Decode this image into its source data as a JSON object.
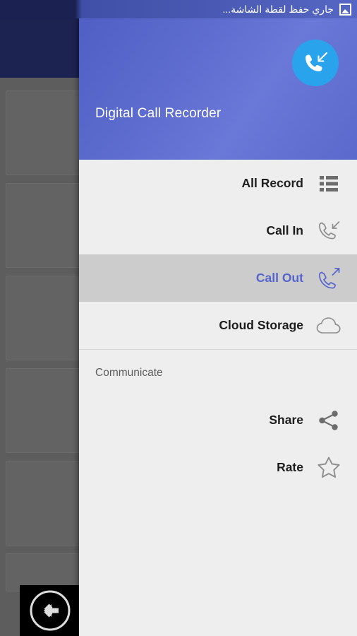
{
  "status_bar": {
    "text": "جاري حفظ لقطة الشاشة...",
    "icon": "image-icon",
    "background_color": "#4a5ab4"
  },
  "drawer": {
    "header": {
      "app_title": "Digital Call Recorder",
      "avatar_icon": "phone-incoming-icon",
      "avatar_color": "#29a3ec",
      "gradient_from": "#4f5fc4",
      "gradient_to": "#6a78d8"
    },
    "menu_groups": [
      {
        "id": "main",
        "section_label": "",
        "items": [
          {
            "label": "All Record",
            "icon": "list-record-icon",
            "selected": false
          },
          {
            "label": "Call In",
            "icon": "phone-incoming-icon",
            "selected": false
          },
          {
            "label": "Call Out",
            "icon": "phone-outgoing-icon",
            "selected": true
          },
          {
            "label": "Cloud Storage",
            "icon": "cloud-icon",
            "selected": false
          }
        ]
      },
      {
        "id": "communicate",
        "section_label": "Communicate",
        "items": [
          {
            "label": "Share",
            "icon": "share-icon",
            "selected": false
          },
          {
            "label": "Rate",
            "icon": "star-outline-icon",
            "selected": false
          }
        ]
      }
    ],
    "selected_item_label": "Call Out",
    "selected_text_color": "#5565cb",
    "selected_row_color": "#cccccc",
    "background_color": "#eeeeee"
  },
  "background_app": {
    "appbar_color": "#1c2350",
    "scrim_color": "#5d5d5d",
    "back_button_icon": "back-arrow-circle-icon"
  }
}
